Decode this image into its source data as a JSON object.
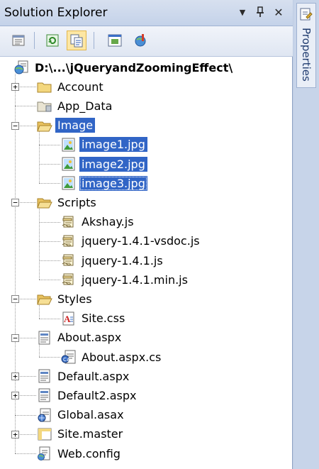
{
  "window": {
    "title": "Solution Explorer",
    "pin_glyph": "📌",
    "close_glyph": "✕",
    "dropdown_glyph": "▼"
  },
  "side_panel": {
    "tab_label": "Properties"
  },
  "colors": {
    "selection": "#3165c6",
    "titlebar": "#c4d2e9",
    "folder": "#f3d77e"
  },
  "tree": {
    "root": {
      "label": "D:\\...\\jQueryandZoomingEffect\\",
      "icon": "web-project-icon"
    },
    "items": [
      {
        "label": "Account",
        "icon": "folder-icon",
        "level": 1,
        "expander": "+"
      },
      {
        "label": "App_Data",
        "icon": "special-folder-icon",
        "level": 1,
        "expander": ""
      },
      {
        "label": "Image",
        "icon": "open-folder-icon",
        "level": 1,
        "expander": "−",
        "selected": true
      },
      {
        "label": "image1.jpg",
        "icon": "image-file-icon",
        "level": 2,
        "expander": "",
        "selected": true
      },
      {
        "label": "image2.jpg",
        "icon": "image-file-icon",
        "level": 2,
        "expander": "",
        "selected": true
      },
      {
        "label": "image3.jpg",
        "icon": "image-file-icon",
        "level": 2,
        "expander": "",
        "selected": true,
        "focused": true
      },
      {
        "label": "Scripts",
        "icon": "open-folder-icon",
        "level": 1,
        "expander": "−"
      },
      {
        "label": "Akshay.js",
        "icon": "script-file-icon",
        "level": 2,
        "expander": ""
      },
      {
        "label": "jquery-1.4.1-vsdoc.js",
        "icon": "script-file-icon",
        "level": 2,
        "expander": ""
      },
      {
        "label": "jquery-1.4.1.js",
        "icon": "script-file-icon",
        "level": 2,
        "expander": ""
      },
      {
        "label": "jquery-1.4.1.min.js",
        "icon": "script-file-icon",
        "level": 2,
        "expander": ""
      },
      {
        "label": "Styles",
        "icon": "open-folder-icon",
        "level": 1,
        "expander": "−"
      },
      {
        "label": "Site.css",
        "icon": "css-file-icon",
        "level": 2,
        "expander": ""
      },
      {
        "label": "About.aspx",
        "icon": "aspx-file-icon",
        "level": 1,
        "expander": "−"
      },
      {
        "label": "About.aspx.cs",
        "icon": "cs-file-icon",
        "level": 2,
        "expander": ""
      },
      {
        "label": "Default.aspx",
        "icon": "aspx-file-icon",
        "level": 1,
        "expander": "+"
      },
      {
        "label": "Default2.aspx",
        "icon": "aspx-file-icon",
        "level": 1,
        "expander": "+"
      },
      {
        "label": "Global.asax",
        "icon": "global-asax-icon",
        "level": 1,
        "expander": ""
      },
      {
        "label": "Site.master",
        "icon": "master-page-icon",
        "level": 1,
        "expander": "+"
      },
      {
        "label": "Web.config",
        "icon": "config-file-icon",
        "level": 1,
        "expander": ""
      }
    ]
  },
  "toolbar": {
    "buttons": [
      {
        "name": "properties-tool-button",
        "icon": "properties-icon"
      },
      {
        "name": "refresh-tool-button",
        "icon": "refresh-icon"
      },
      {
        "name": "show-all-files-tool-button",
        "icon": "show-all-files-icon",
        "active": true
      },
      {
        "name": "view-designer-tool-button",
        "icon": "view-designer-icon"
      },
      {
        "name": "asp-config-tool-button",
        "icon": "asp-config-icon"
      }
    ]
  }
}
